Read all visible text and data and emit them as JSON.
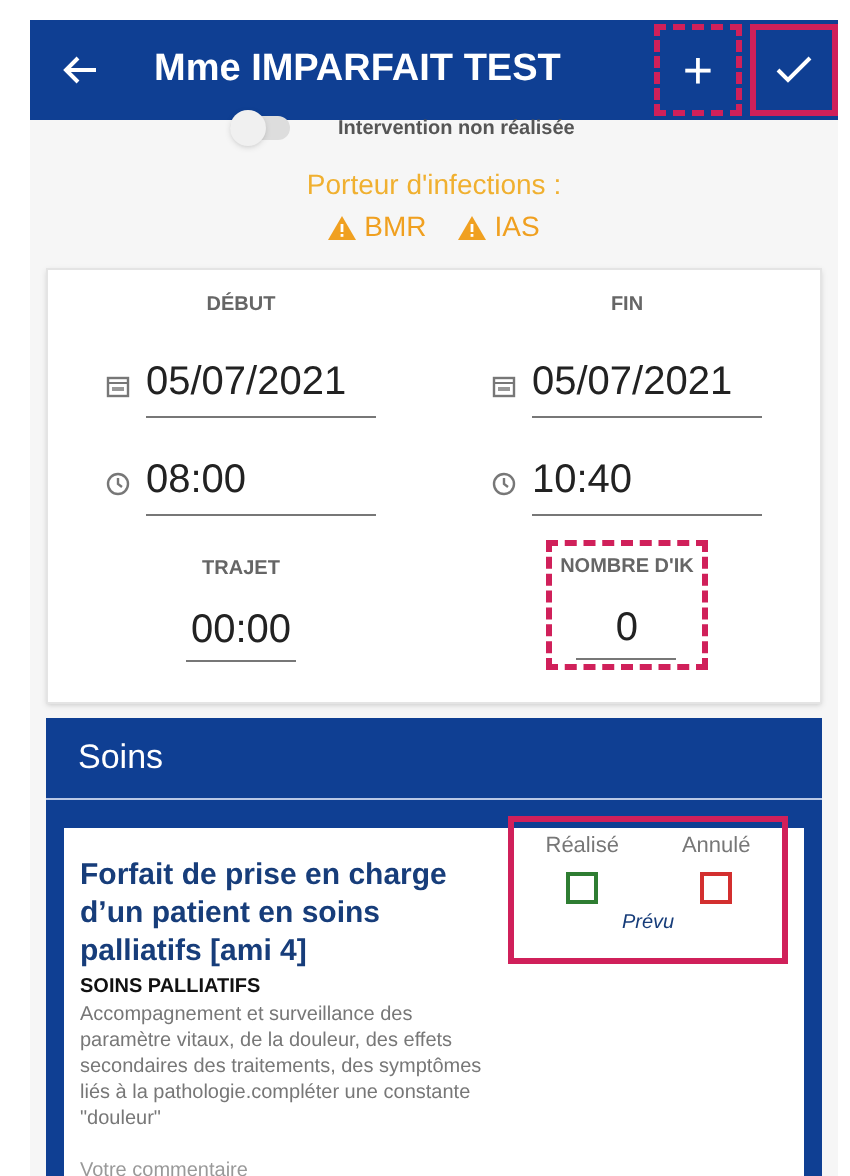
{
  "header": {
    "title": "Mme IMPARFAIT TEST",
    "add": {
      "label": "+",
      "highlighted": true,
      "dashed": true
    },
    "confirm": {
      "highlighted": true,
      "dashed": false
    }
  },
  "intervention": {
    "label": "Intervention non réalisée",
    "on": false
  },
  "infections": {
    "title": "Porteur d'infections :",
    "tags": [
      "BMR",
      "IAS"
    ]
  },
  "times": {
    "start": {
      "label": "DÉBUT",
      "date": "05/07/2021",
      "time": "08:00"
    },
    "end": {
      "label": "FIN",
      "date": "05/07/2021",
      "time": "10:40"
    },
    "trajet": {
      "label": "TRAJET",
      "value": "00:00",
      "highlighted": false
    },
    "ik": {
      "label": "NOMBRE D'IK",
      "value": "0",
      "highlighted": true,
      "dashed": true
    }
  },
  "soins": {
    "title": "Soins",
    "items": [
      {
        "title": "Forfait de prise en charge d’un patient en soins palliatifs [ami 4]",
        "category": "SOINS PALLIATIFS",
        "description": "Accompagnement et surveillance des paramètre vitaux, de la douleur, des effets secondaires des traitements, des symptômes liés à la pathologie.compléter une constante \"douleur\"",
        "comment_placeholder": "Votre commentaire",
        "done_label": "Réalisé",
        "done": false,
        "cancel_label": "Annulé",
        "cancelled": false,
        "status": "Prévu",
        "highlighted": true,
        "dashed": false
      }
    ]
  }
}
